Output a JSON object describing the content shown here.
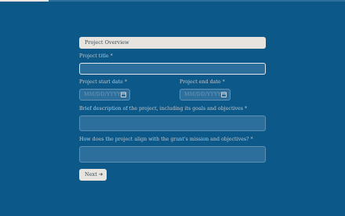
{
  "progress": {
    "value": 0.14
  },
  "form": {
    "section_title": "Project Overview",
    "fields": {
      "project_title": {
        "label": "Project title",
        "required_mark": "*",
        "value": ""
      },
      "start_date": {
        "label": "Project start date",
        "required_mark": "*",
        "placeholder": "MM/DD/YYYY",
        "icon": "calendar-icon"
      },
      "end_date": {
        "label": "Project end date",
        "required_mark": "*",
        "placeholder": "MM/DD/YYYY",
        "icon": "calendar-icon"
      },
      "description": {
        "label": "Brief description of the project, including its goals and objectives",
        "required_mark": "*",
        "value": ""
      },
      "alignment": {
        "label": "How does the project align with the grant's mission and objectives?",
        "required_mark": "*",
        "value": ""
      }
    },
    "next_label": "Next",
    "next_icon": "arrow-right-icon"
  },
  "colors": {
    "background": "#0b5889",
    "field": "#2c6f9c",
    "button": "#e7e4df"
  }
}
